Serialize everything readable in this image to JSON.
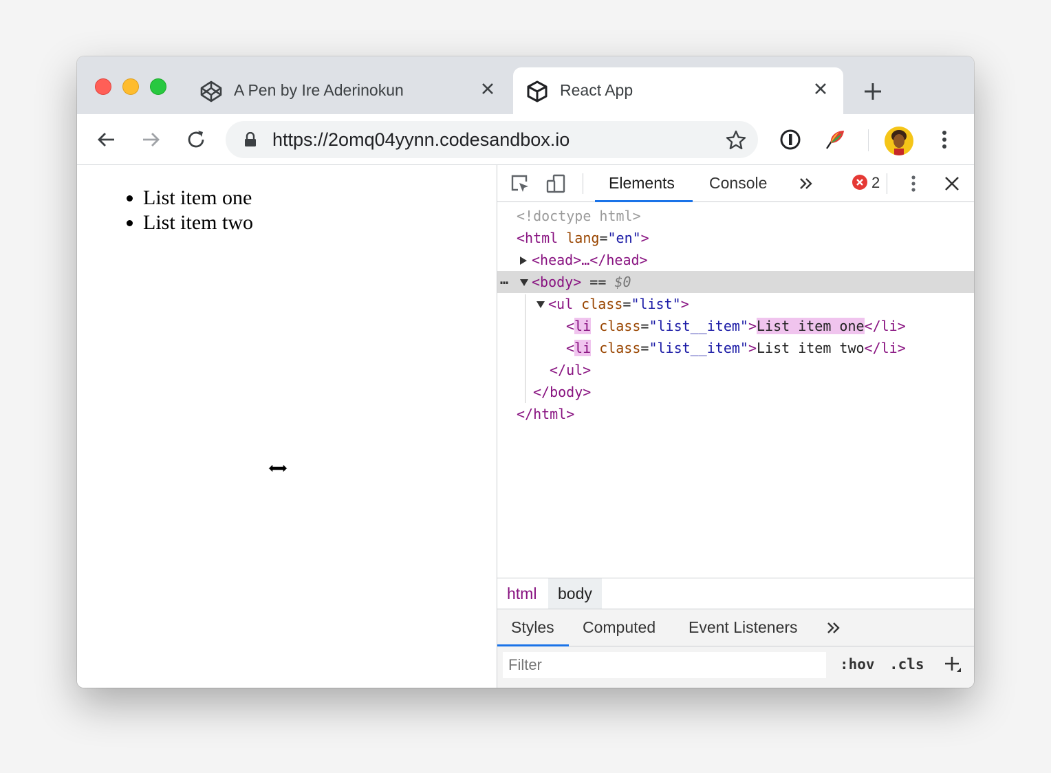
{
  "tabs": [
    {
      "title": "A Pen by Ire Aderinokun",
      "icon": "codepen-icon",
      "active": false
    },
    {
      "title": "React App",
      "icon": "codesandbox-icon",
      "active": true
    }
  ],
  "address": {
    "url": "https://2omq04yynn.codesandbox.io"
  },
  "page": {
    "items": [
      "List item one",
      "List item two"
    ]
  },
  "devtools": {
    "tabs": {
      "elements": "Elements",
      "console": "Console"
    },
    "error_count": "2",
    "dom": {
      "doctype": "<!doctype html>",
      "html_open_tag": "<html",
      "lang_attr": "lang",
      "lang_val": "\"en\"",
      "head": "<head>…</head>",
      "body_tag": "<body>",
      "eq_ref": "==",
      "ref_var": "$0",
      "ul_tag": "<ul",
      "class_attr": "class",
      "ul_class_val": "\"list\"",
      "li_name": "li",
      "li_class_val": "\"list__item\"",
      "li1_text": "List item one",
      "li2_text": "List item two",
      "li_close": "</li>",
      "ul_close": "</ul>",
      "body_close": "</body>",
      "html_close": "</html>"
    },
    "breadcrumbs": [
      "html",
      "body"
    ],
    "subtabs": {
      "styles": "Styles",
      "computed": "Computed",
      "listeners": "Event Listeners"
    },
    "filter_placeholder": "Filter",
    "hov": ":hov",
    "cls": ".cls"
  },
  "colors": {
    "accent": "#1a73e8",
    "tag": "#881280",
    "attr": "#994500",
    "value": "#1a1aa6",
    "error": "#e53935"
  }
}
